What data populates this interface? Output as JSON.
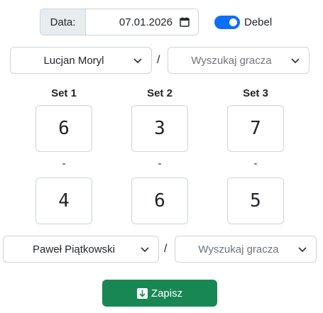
{
  "date": {
    "label": "Data:",
    "value": "07.01.2026"
  },
  "doubles": {
    "label": "Debel",
    "checked": true
  },
  "team1": {
    "player1": "Lucjan Moryl",
    "player2_placeholder": "Wyszukaj gracza"
  },
  "team2": {
    "player1": "Paweł Piątkowski",
    "player2_placeholder": "Wyszukaj gracza"
  },
  "separator": "/",
  "sets": [
    {
      "title": "Set 1",
      "score_top": "6",
      "score_bottom": "4"
    },
    {
      "title": "Set 2",
      "score_top": "3",
      "score_bottom": "6"
    },
    {
      "title": "Set 3",
      "score_top": "7",
      "score_bottom": "5"
    }
  ],
  "score_dash": "-",
  "save_button": {
    "label": "Zapisz"
  },
  "colors": {
    "primary": "#0d6efd",
    "success": "#198754",
    "border": "#ced4da"
  }
}
